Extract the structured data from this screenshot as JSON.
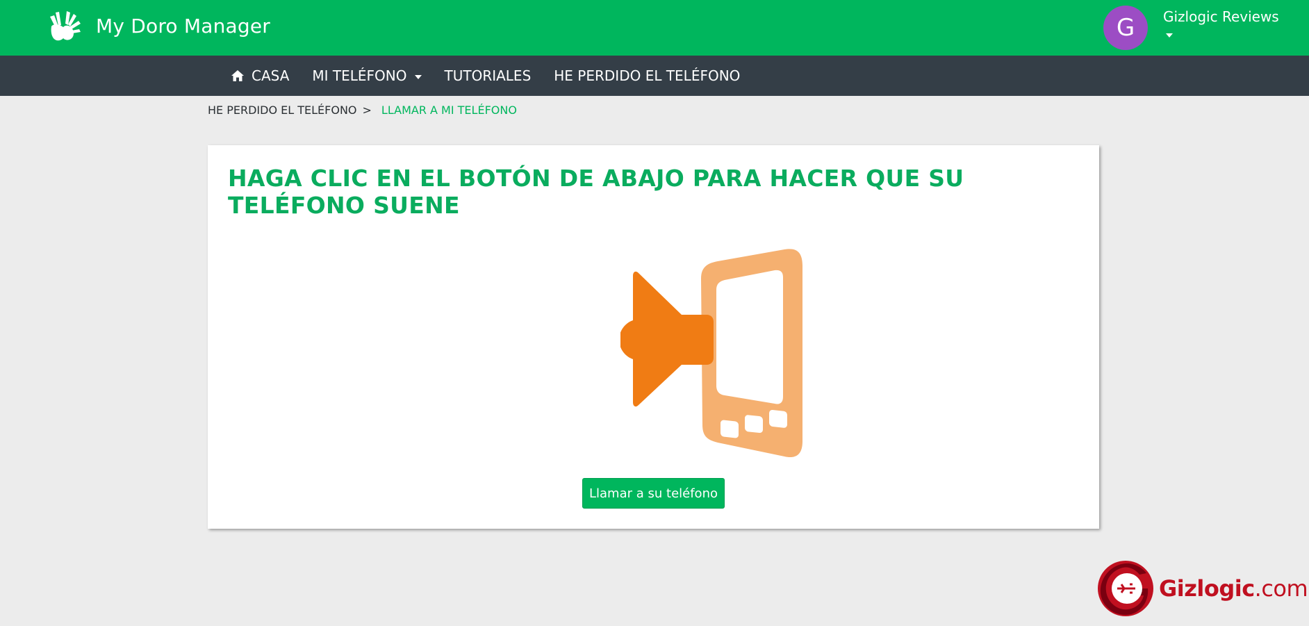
{
  "header": {
    "app_name": "My Doro Manager",
    "logo_icon": "hands-logo-icon",
    "user": {
      "avatar_initial": "G",
      "avatar_color": "#9c4dc4",
      "name": "Gizlogic Reviews"
    }
  },
  "nav": {
    "items": [
      {
        "label": "CASA",
        "icon": "home-icon"
      },
      {
        "label": "MI TELÉFONO",
        "has_dropdown": true
      },
      {
        "label": "TUTORIALES"
      },
      {
        "label": "HE PERDIDO EL TELÉFONO"
      }
    ]
  },
  "breadcrumb": {
    "parent": "HE PERDIDO EL TELÉFONO",
    "separator": ">",
    "current": "LLAMAR A MI TELÉFONO"
  },
  "card": {
    "title": "HAGA CLIC EN EL BOTÓN DE ABAJO PARA HACER QUE SU TELÉFONO SUENE",
    "illustration_icon": "ringing-phone-icon",
    "call_button_label": "Llamar a su teléfono"
  },
  "watermark": {
    "name": "Gizlogic",
    "dot": ".",
    "tld": "com"
  },
  "colors": {
    "brand_green": "#00b65d",
    "nav_dark": "#343e47",
    "page_bg": "#ececec",
    "speaker_orange": "#f07c14",
    "phone_orange": "#f5b070",
    "watermark_red": "#c01020"
  }
}
